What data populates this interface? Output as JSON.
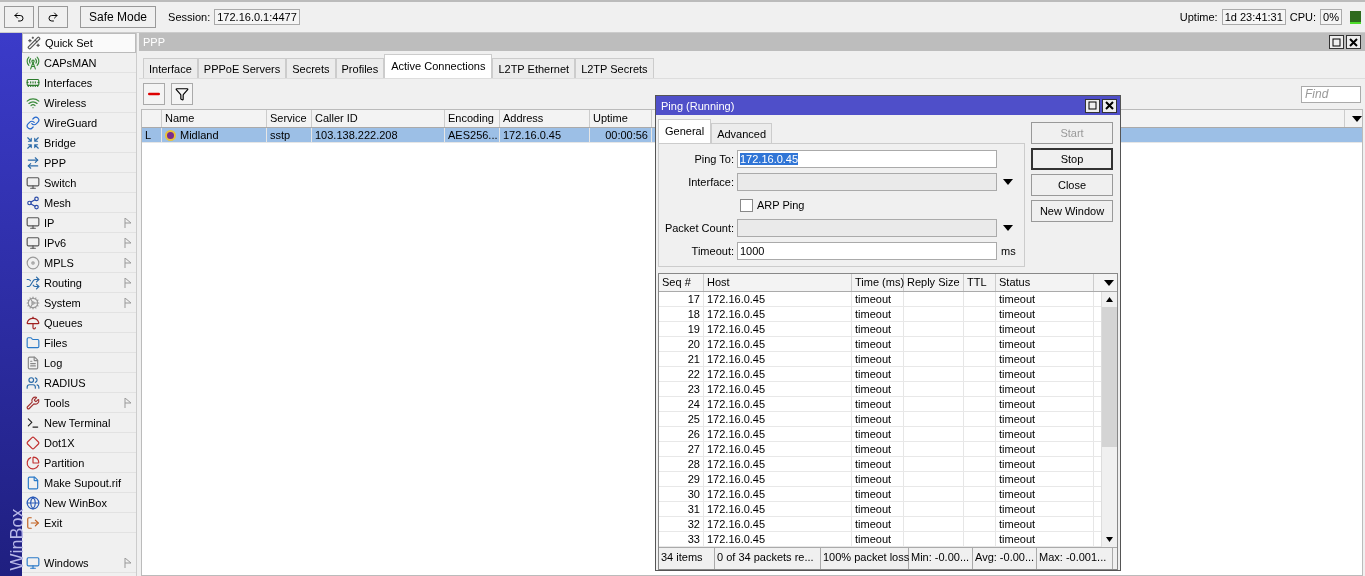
{
  "toolbar": {
    "safe_mode": "Safe Mode",
    "session_label": "Session:",
    "session": "172.16.0.1:4477",
    "uptime_label": "Uptime:",
    "uptime": "1d 23:41:31",
    "cpu_label": "CPU:",
    "cpu": "0%"
  },
  "sidebar": {
    "brand": "WinBox",
    "items": [
      {
        "label": "Quick Set",
        "submenu": false,
        "selected": true
      },
      {
        "label": "CAPsMAN",
        "submenu": false,
        "selected": false
      },
      {
        "label": "Interfaces",
        "submenu": false,
        "selected": false
      },
      {
        "label": "Wireless",
        "submenu": false,
        "selected": false
      },
      {
        "label": "WireGuard",
        "submenu": false,
        "selected": false
      },
      {
        "label": "Bridge",
        "submenu": false,
        "selected": false
      },
      {
        "label": "PPP",
        "submenu": false,
        "selected": false
      },
      {
        "label": "Switch",
        "submenu": false,
        "selected": false
      },
      {
        "label": "Mesh",
        "submenu": false,
        "selected": false
      },
      {
        "label": "IP",
        "submenu": true,
        "selected": false
      },
      {
        "label": "IPv6",
        "submenu": true,
        "selected": false
      },
      {
        "label": "MPLS",
        "submenu": true,
        "selected": false
      },
      {
        "label": "Routing",
        "submenu": true,
        "selected": false
      },
      {
        "label": "System",
        "submenu": true,
        "selected": false
      },
      {
        "label": "Queues",
        "submenu": false,
        "selected": false
      },
      {
        "label": "Files",
        "submenu": false,
        "selected": false
      },
      {
        "label": "Log",
        "submenu": false,
        "selected": false
      },
      {
        "label": "RADIUS",
        "submenu": false,
        "selected": false
      },
      {
        "label": "Tools",
        "submenu": true,
        "selected": false
      },
      {
        "label": "New Terminal",
        "submenu": false,
        "selected": false
      },
      {
        "label": "Dot1X",
        "submenu": false,
        "selected": false
      },
      {
        "label": "Partition",
        "submenu": false,
        "selected": false
      },
      {
        "label": "Make Supout.rif",
        "submenu": false,
        "selected": false
      },
      {
        "label": "New WinBox",
        "submenu": false,
        "selected": false
      },
      {
        "label": "Exit",
        "submenu": false,
        "selected": false
      }
    ],
    "bottom_item": {
      "label": "Windows",
      "submenu": true
    }
  },
  "ppp_window": {
    "title": "PPP",
    "tabs": [
      {
        "label": "Interface",
        "selected": false
      },
      {
        "label": "PPPoE Servers",
        "selected": false
      },
      {
        "label": "Secrets",
        "selected": false
      },
      {
        "label": "Profiles",
        "selected": false
      },
      {
        "label": "Active Connections",
        "selected": true
      },
      {
        "label": "L2TP Ethernet",
        "selected": false
      },
      {
        "label": "L2TP Secrets",
        "selected": false
      }
    ],
    "find_placeholder": "Find",
    "columns": [
      "",
      "Name",
      "Service",
      "Caller ID",
      "Encoding",
      "Address",
      "Uptime"
    ],
    "rows": [
      {
        "selected": true,
        "cells": [
          "L",
          "Midland",
          "sstp",
          "103.138.222.208",
          "AES256...",
          "172.16.0.45",
          "00:00:56"
        ]
      }
    ]
  },
  "ping_window": {
    "title": "Ping (Running)",
    "tabs": [
      {
        "label": "General",
        "selected": true
      },
      {
        "label": "Advanced",
        "selected": false
      }
    ],
    "ping_to_label": "Ping To:",
    "ping_to": "172.16.0.45",
    "interface_label": "Interface:",
    "arp_ping": {
      "label": "ARP Ping",
      "checked": false
    },
    "packet_count_label": "Packet Count:",
    "timeout_label": "Timeout:",
    "timeout": "1000",
    "timeout_unit": "ms",
    "buttons": [
      {
        "label": "Start",
        "disabled": true
      },
      {
        "label": "Stop",
        "disabled": false
      },
      {
        "label": "Close",
        "disabled": false
      },
      {
        "label": "New Window",
        "disabled": false
      }
    ],
    "columns": [
      "Seq #",
      "Host",
      "Time (ms)",
      "Reply Size",
      "TTL",
      "Status"
    ],
    "rows": [
      [
        "17",
        "172.16.0.45",
        "timeout",
        "",
        "",
        "timeout"
      ],
      [
        "18",
        "172.16.0.45",
        "timeout",
        "",
        "",
        "timeout"
      ],
      [
        "19",
        "172.16.0.45",
        "timeout",
        "",
        "",
        "timeout"
      ],
      [
        "20",
        "172.16.0.45",
        "timeout",
        "",
        "",
        "timeout"
      ],
      [
        "21",
        "172.16.0.45",
        "timeout",
        "",
        "",
        "timeout"
      ],
      [
        "22",
        "172.16.0.45",
        "timeout",
        "",
        "",
        "timeout"
      ],
      [
        "23",
        "172.16.0.45",
        "timeout",
        "",
        "",
        "timeout"
      ],
      [
        "24",
        "172.16.0.45",
        "timeout",
        "",
        "",
        "timeout"
      ],
      [
        "25",
        "172.16.0.45",
        "timeout",
        "",
        "",
        "timeout"
      ],
      [
        "26",
        "172.16.0.45",
        "timeout",
        "",
        "",
        "timeout"
      ],
      [
        "27",
        "172.16.0.45",
        "timeout",
        "",
        "",
        "timeout"
      ],
      [
        "28",
        "172.16.0.45",
        "timeout",
        "",
        "",
        "timeout"
      ],
      [
        "29",
        "172.16.0.45",
        "timeout",
        "",
        "",
        "timeout"
      ],
      [
        "30",
        "172.16.0.45",
        "timeout",
        "",
        "",
        "timeout"
      ],
      [
        "31",
        "172.16.0.45",
        "timeout",
        "",
        "",
        "timeout"
      ],
      [
        "32",
        "172.16.0.45",
        "timeout",
        "",
        "",
        "timeout"
      ],
      [
        "33",
        "172.16.0.45",
        "timeout",
        "",
        "",
        "timeout"
      ]
    ],
    "status_bar": [
      "34 items",
      "0 of 34 packets re...",
      "100% packet loss",
      "Min: -0.00...",
      "Avg: -0.00...",
      "Max: -0.001..."
    ]
  }
}
